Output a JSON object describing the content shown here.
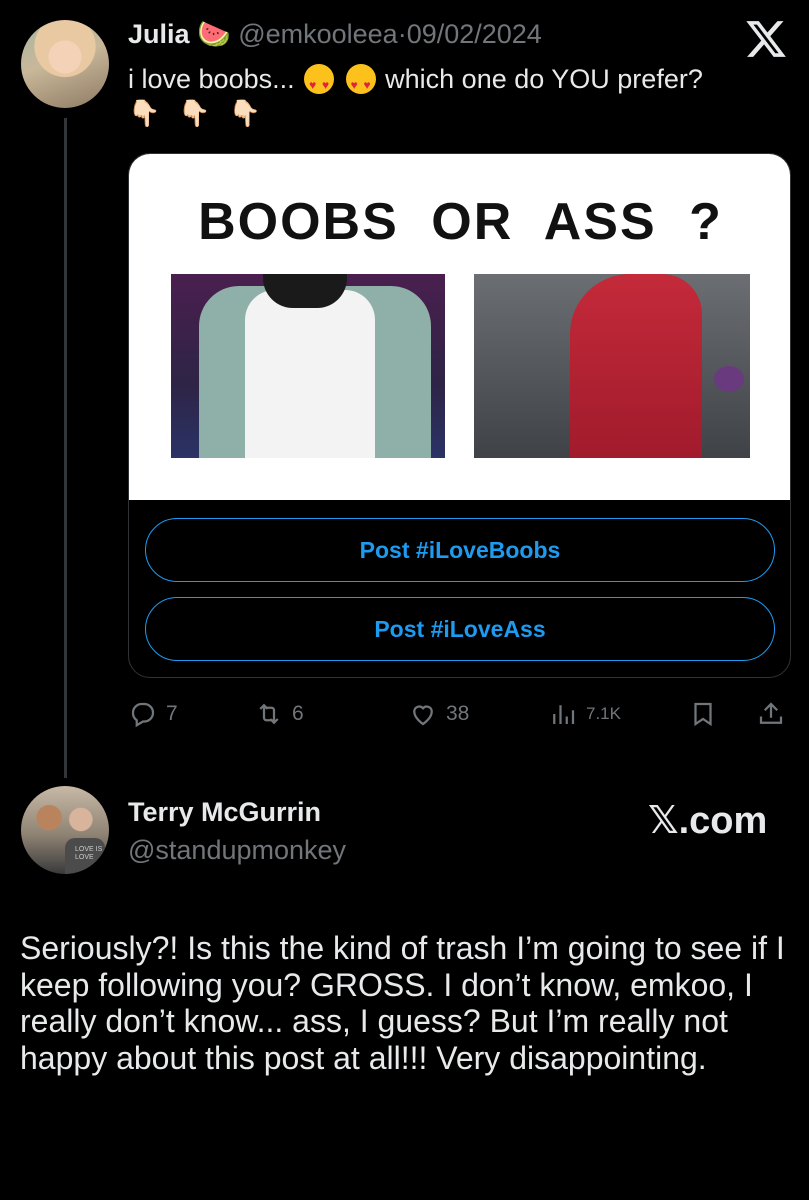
{
  "tweet": {
    "author_name": "Julia",
    "author_emoji": "🍉",
    "handle": "@emkooleea",
    "separator": "·",
    "date": "09/02/2024",
    "text_start": "i love boobs...",
    "text_end": "which one do YOU prefer?",
    "pointing_emojis": [
      "👇🏻",
      "👇🏻",
      "👇🏻"
    ],
    "card": {
      "headline": "BOOBS OR ASS ?",
      "button_1": "Post #iLoveBoobs",
      "button_2": "Post #iLoveAss"
    },
    "actions": {
      "replies": "7",
      "reposts": "6",
      "likes": "38",
      "views": "7.1K"
    }
  },
  "reply": {
    "author_name": "Terry McGurrin",
    "handle": "@standupmonkey",
    "avatar_shirt_text": "LOVE IS LOVE",
    "brand": "𝕏.com",
    "text": "Seriously?! Is this the kind of trash I’m going to see if I keep following you? GROSS. I don’t know, emkoo, I really don’t know... ass, I guess? But I’m really not happy about this post at all!!! Very disappointing."
  },
  "colors": {
    "background": "#000000",
    "text_primary": "#e7e9ea",
    "text_secondary": "#71767b",
    "accent": "#1d9bf0"
  },
  "icons": [
    "x-logo-icon",
    "reply-icon",
    "repost-icon",
    "like-icon",
    "views-icon",
    "bookmark-icon",
    "share-icon"
  ]
}
